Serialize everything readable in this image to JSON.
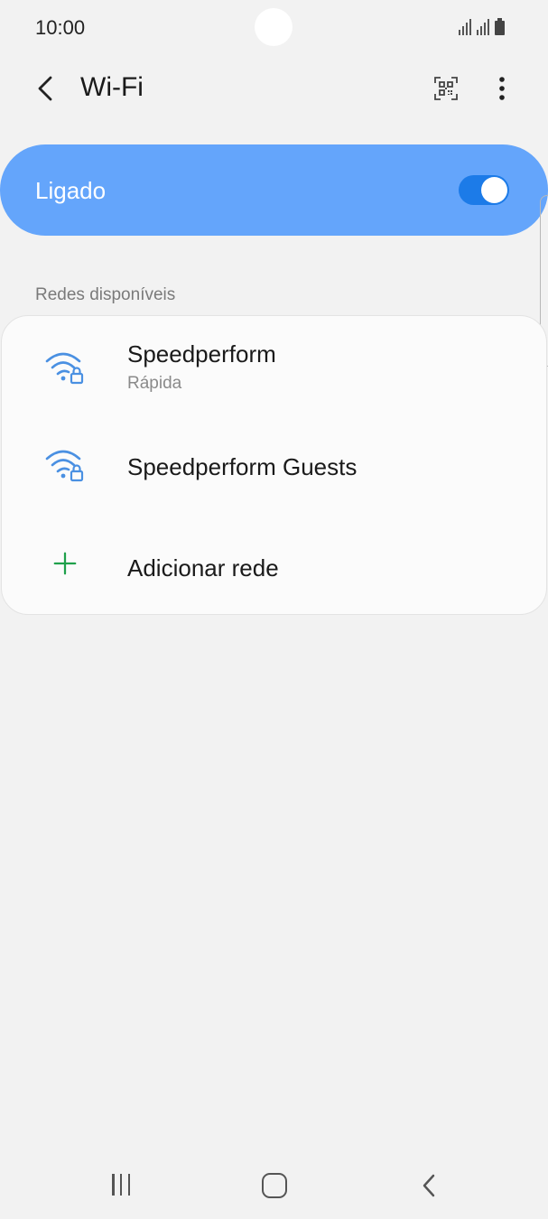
{
  "status_bar": {
    "time": "10:00"
  },
  "app_bar": {
    "title": "Wi-Fi"
  },
  "master_switch": {
    "label": "Ligado",
    "on": true
  },
  "section": {
    "label": "Redes disponíveis"
  },
  "networks": [
    {
      "name": "Speedperform",
      "subtitle": "Rápida",
      "secured": true
    },
    {
      "name": "Speedperform Guests",
      "subtitle": "",
      "secured": true
    }
  ],
  "add_network": {
    "label": "Adicionar rede"
  },
  "colors": {
    "background": "#f2f2f2",
    "master_switch_bg": "#64a5fb",
    "toggle_track": "#1c7be8",
    "wifi_icon": "#4a90e2",
    "add_icon": "#1fa04b"
  }
}
